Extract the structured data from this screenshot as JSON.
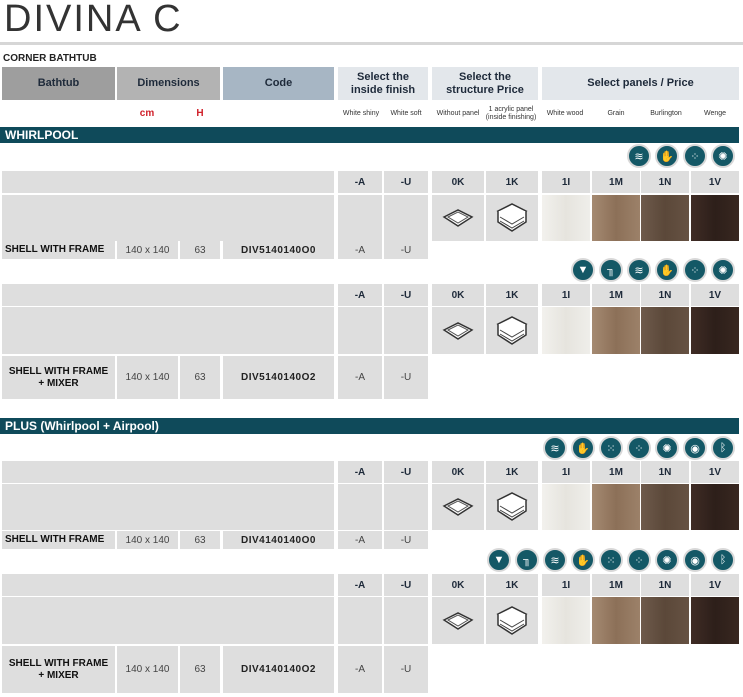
{
  "title": "DIVINA C",
  "subtitle": "CORNER BATHTUB",
  "headers": {
    "bathtub": "Bathtub",
    "dimensions": "Dimensions",
    "code": "Code",
    "finish": "Select the inside finish",
    "structure": "Select the structure Price",
    "panels": "Select panels / Price"
  },
  "subheaders": {
    "cm": "cm",
    "h": "H",
    "white_shiny": "White shiny",
    "white_soft": "White soft",
    "without_panel": "Without panel",
    "acrylic_panel": "1 acrylic panel (inside finishing)",
    "white_wood": "White wood",
    "grain": "Grain",
    "burlington": "Burlington",
    "wenge": "Wenge"
  },
  "columns": {
    "finish_a": "-A",
    "finish_u": "-U",
    "struct_0k": "0K",
    "struct_1k": "1K",
    "panel_1i": "1I",
    "panel_1m": "1M",
    "panel_1n": "1N",
    "panel_1v": "1V"
  },
  "sections": [
    {
      "name": "WHIRLPOOL"
    },
    {
      "name": "PLUS (Whirlpool + Airpool)"
    }
  ],
  "rows": [
    {
      "label": "SHELL WITH FRAME",
      "dim": "140 x 140",
      "h": "63",
      "code": "DIV5140140O0",
      "a": "-A",
      "u": "-U",
      "icons": [
        "hydro-icon",
        "massage-icon",
        "bubbles-icon",
        "jets-icon"
      ]
    },
    {
      "label": "SHELL WITH FRAME + MIXER",
      "dim": "140 x 140",
      "h": "63",
      "code": "DIV5140140O2",
      "a": "-A",
      "u": "-U",
      "icons": [
        "water-drop-icon",
        "faucet-icon",
        "hydro-icon",
        "massage-icon",
        "bubbles-icon",
        "jets-icon"
      ]
    },
    {
      "label": "SHELL WITH FRAME",
      "dim": "140 x 140",
      "h": "63",
      "code": "DIV4140140O0",
      "a": "-A",
      "u": "-U",
      "icons": [
        "hydro-icon",
        "massage-icon",
        "air-bubbles-icon",
        "bubbles-icon",
        "jets-icon",
        "chromotherapy-icon",
        "bluetooth-icon"
      ]
    },
    {
      "label": "SHELL WITH FRAME + MIXER",
      "dim": "140 x 140",
      "h": "63",
      "code": "DIV4140140O2",
      "a": "-A",
      "u": "-U",
      "icons": [
        "water-drop-icon",
        "faucet-icon",
        "hydro-icon",
        "massage-icon",
        "air-bubbles-icon",
        "bubbles-icon",
        "jets-icon",
        "chromotherapy-icon",
        "bluetooth-icon"
      ]
    }
  ],
  "colors": {
    "section_bg": "#0f4a5a",
    "icon_bg": "#145866",
    "unit_red": "#d0202a"
  }
}
